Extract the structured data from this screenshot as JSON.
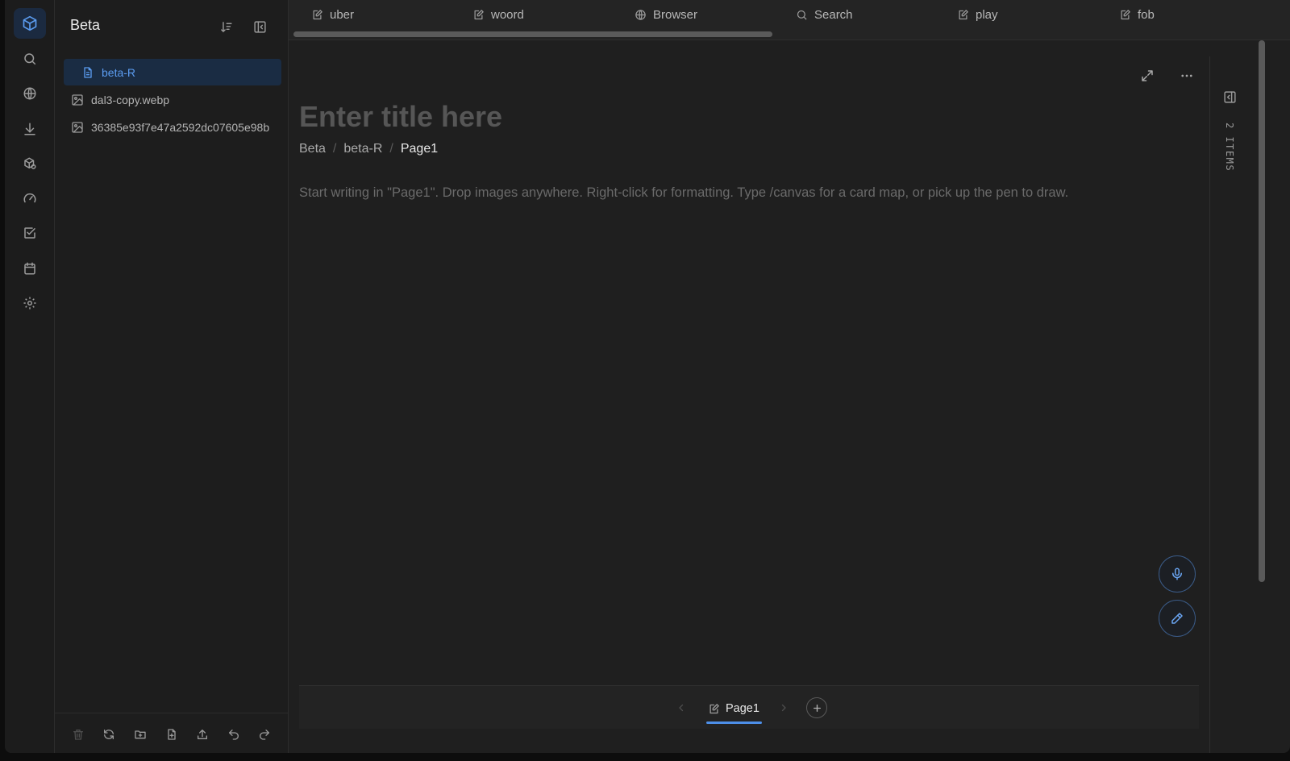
{
  "rail": {
    "items": [
      {
        "name": "cube-icon",
        "active": true
      },
      {
        "name": "search-icon"
      },
      {
        "name": "globe-icon"
      },
      {
        "name": "download-icon"
      },
      {
        "name": "packages-icon"
      },
      {
        "name": "gauge-icon"
      },
      {
        "name": "checkbox-icon"
      },
      {
        "name": "calendar-icon"
      },
      {
        "name": "gear-icon"
      }
    ]
  },
  "panel": {
    "title": "Beta",
    "items": [
      {
        "label": "beta-R",
        "icon": "document-icon",
        "selected": true
      },
      {
        "label": "dal3-copy.webp",
        "icon": "image-icon"
      },
      {
        "label": "36385e93f7e47a2592dc07605e98b",
        "icon": "image-icon"
      }
    ],
    "footer_icons": [
      "trash-icon",
      "refresh-icon",
      "new-folder-icon",
      "new-file-icon",
      "upload-icon",
      "undo-icon",
      "redo-icon"
    ]
  },
  "tabs": [
    {
      "label": "uber",
      "icon": "edit-doc-icon"
    },
    {
      "label": "woord",
      "icon": "edit-doc-icon"
    },
    {
      "label": "Browser",
      "icon": "globe-icon"
    },
    {
      "label": "Search",
      "icon": "search-icon"
    },
    {
      "label": "play",
      "icon": "edit-doc-icon"
    },
    {
      "label": "fob",
      "icon": "edit-doc-icon"
    }
  ],
  "editor": {
    "title_placeholder": "Enter title here",
    "breadcrumb": [
      "Beta",
      "beta-R",
      "Page1"
    ],
    "body_placeholder": "Start writing in \"Page1\". Drop images anywhere. Right-click for formatting. Type /canvas for a card map, or pick up the pen to draw.",
    "toolbar_icons": [
      "expand-icon",
      "more-icon"
    ],
    "fab_icons": [
      "microphone-icon",
      "pen-icon"
    ]
  },
  "pages": {
    "current": "Page1"
  },
  "right_pane": {
    "count_label": "2 ITEMS"
  },
  "colors": {
    "accent": "#4d8fe8",
    "background": "#1f1f1f",
    "selected_bg": "#1a2c43"
  }
}
